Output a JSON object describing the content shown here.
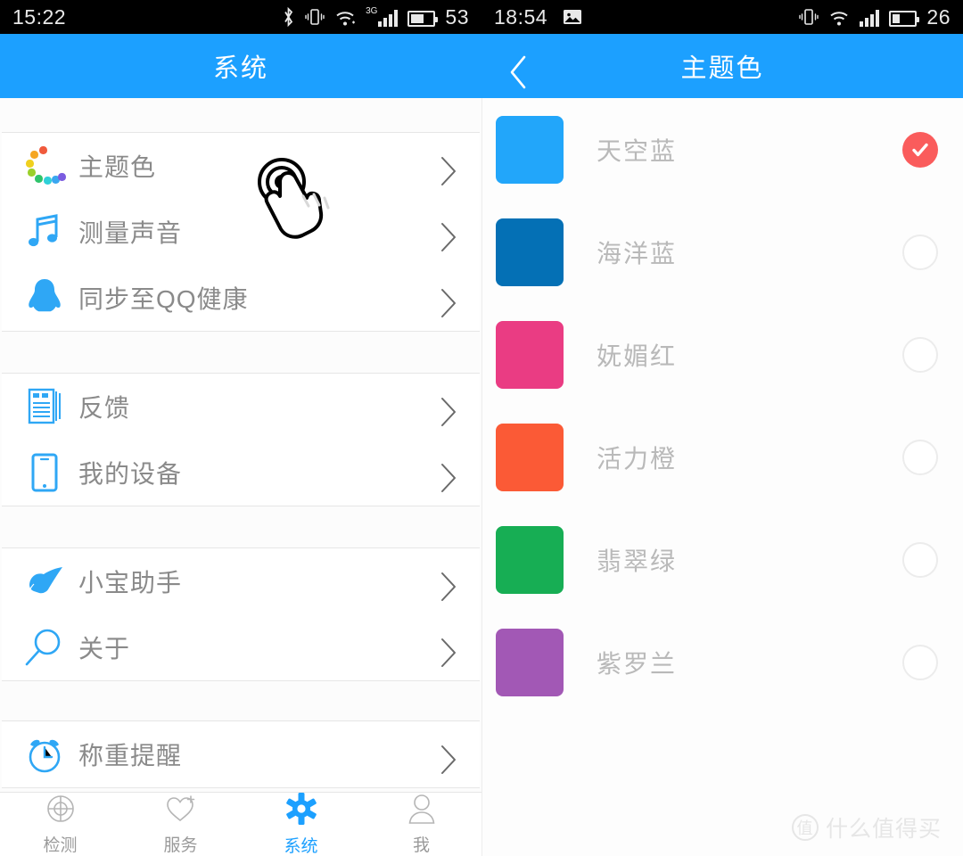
{
  "status_bars": [
    {
      "id": "left",
      "time": "15:22",
      "battery": "53",
      "icons": [
        "bluetooth-icon",
        "vibrate-icon",
        "wifi-icon",
        "signal-3g-icon",
        "battery-icon"
      ],
      "network": "3G"
    },
    {
      "id": "right",
      "time": "18:54",
      "battery": "26",
      "icons": [
        "image-icon",
        "vibrate-icon",
        "wifi-icon",
        "signal-icon",
        "battery-icon"
      ],
      "network": ""
    }
  ],
  "left_screen": {
    "header": {
      "title": "系统"
    },
    "groups": [
      {
        "rows": [
          {
            "label": "主题色",
            "icon": "color-ring-icon",
            "chevron": "chevron-right-icon"
          },
          {
            "label": "测量声音",
            "icon": "music-note-icon",
            "chevron": "chevron-right-icon"
          },
          {
            "label": "同步至QQ健康",
            "icon": "qq-penguin-icon",
            "chevron": "chevron-right-icon"
          }
        ]
      },
      {
        "rows": [
          {
            "label": "反馈",
            "icon": "document-icon",
            "chevron": "chevron-right-icon"
          },
          {
            "label": "我的设备",
            "icon": "phone-icon",
            "chevron": "chevron-right-icon"
          }
        ]
      },
      {
        "rows": [
          {
            "label": "小宝助手",
            "icon": "pointing-hand-icon",
            "chevron": "chevron-right-icon"
          },
          {
            "label": "关于",
            "icon": "magnifier-icon",
            "chevron": "chevron-right-icon"
          }
        ]
      },
      {
        "rows": [
          {
            "label": "称重提醒",
            "icon": "alarm-clock-icon",
            "chevron": "chevron-right-icon"
          }
        ]
      }
    ],
    "bottom_nav": [
      {
        "label": "检测",
        "icon": "crosshair-icon",
        "active": false
      },
      {
        "label": "服务",
        "icon": "heart-plus-icon",
        "active": false
      },
      {
        "label": "系统",
        "icon": "gear-icon",
        "active": true
      },
      {
        "label": "我",
        "icon": "person-icon",
        "active": false
      }
    ]
  },
  "right_screen": {
    "header": {
      "title": "主题色",
      "back_icon": "chevron-left-icon"
    },
    "colors": [
      {
        "label": "天空蓝",
        "hex": "#22a6fa",
        "selected": true
      },
      {
        "label": "海洋蓝",
        "hex": "#0470b5",
        "selected": false
      },
      {
        "label": "妩媚红",
        "hex": "#ea3c83",
        "selected": false
      },
      {
        "label": "活力橙",
        "hex": "#fb5a36",
        "selected": false
      },
      {
        "label": "翡翠绿",
        "hex": "#17ae54",
        "selected": false
      },
      {
        "label": "紫罗兰",
        "hex": "#a258b5",
        "selected": false
      }
    ],
    "selected_color": "天空蓝",
    "check_color": "#fa5c5c"
  },
  "theme": {
    "header_blue": "#1ca0ff",
    "accent_blue": "#2fa7f5",
    "label_gray": "#8a8a8a",
    "color_label_gray": "#b9b9b9"
  },
  "watermark": {
    "badge": "值",
    "text": "什么值得买"
  },
  "overlay": {
    "cursor_icon": "tap-gesture-cursor-icon"
  }
}
